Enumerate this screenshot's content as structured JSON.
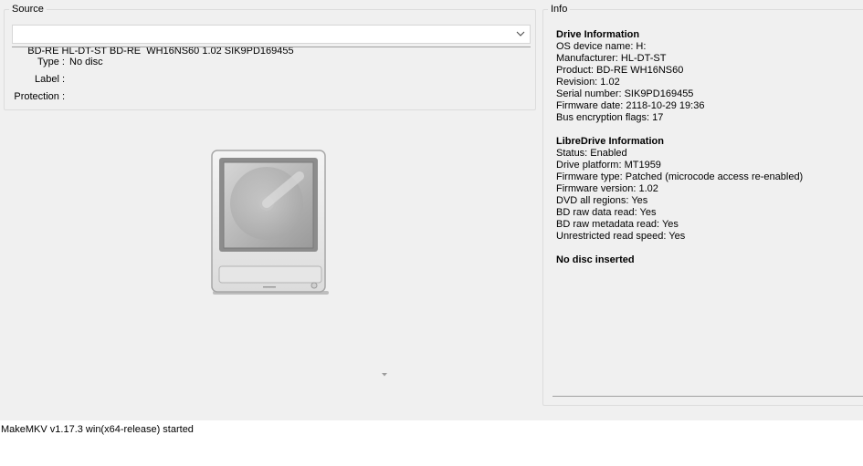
{
  "source": {
    "title": "Source",
    "drive_selected": "BD-RE HL-DT-ST BD-RE  WH16NS60 1.02 SIK9PD169455",
    "fields": [
      {
        "label": "Type :",
        "value": "No disc"
      },
      {
        "label": "Label :",
        "value": ""
      },
      {
        "label": "Protection :",
        "value": ""
      }
    ]
  },
  "info": {
    "title": "Info",
    "drive_heading": "Drive Information",
    "drive_lines": [
      "OS device name: H:",
      "Manufacturer: HL-DT-ST",
      "Product: BD-RE WH16NS60",
      "Revision: 1.02",
      "Serial number: SIK9PD169455",
      "Firmware date: 2118-10-29 19:36",
      "Bus encryption flags: 17"
    ],
    "libre_heading": "LibreDrive Information",
    "libre_lines": [
      "Status: Enabled",
      "Drive platform: MT1959",
      "Firmware type: Patched (microcode access re-enabled)",
      "Firmware version: 1.02",
      "DVD all regions: Yes",
      "BD raw data read: Yes",
      "BD raw metadata read: Yes",
      "Unrestricted read speed: Yes"
    ],
    "status_heading": "No disc inserted"
  },
  "log": {
    "lines": [
      "MakeMKV v1.17.3 win(x64-release) started"
    ]
  },
  "icons": {
    "drive": "optical-drive-icon",
    "combo_arrow": "chevron-down-icon",
    "scroll": "triangle-down-icon"
  }
}
